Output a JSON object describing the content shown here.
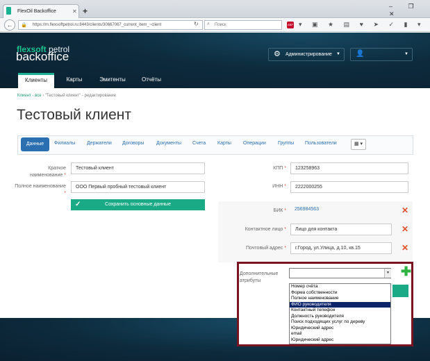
{
  "browser": {
    "tab_title": "FlexOil Backoffice",
    "new_tab": "+",
    "window_buttons": "– ❐ ✕",
    "url": "https://m.flexsoftpetrol.ru:8443/clients/30667067_current_item_~client",
    "search_placeholder": "Поиск",
    "abp": "ABP"
  },
  "brand": {
    "accent": "flexsoft",
    "rest": " petrol",
    "subtitle": "backoffice"
  },
  "header": {
    "admin_label": "Администрирование"
  },
  "nav": [
    "Клиенты",
    "Карты",
    "Эмитенты",
    "Отчёты"
  ],
  "breadcrumb": {
    "root": "Клиент - все",
    "separator": "›",
    "current": "\"Тестовый клиент\" - редактирование"
  },
  "page_title": "Тестовый клиент",
  "tabs": [
    "Данные",
    "Филиалы",
    "Держатели",
    "Договоры",
    "Документы",
    "Счета",
    "Карты",
    "Операции",
    "Группы",
    "Пользователи"
  ],
  "form_left": {
    "short_name_label": "Краткое наименование",
    "short_name_value": "Тестовый клиент",
    "full_name_label": "Полное наименование",
    "full_name_value": "ООО Первый пробный тестовый клиент",
    "save_label": "Сохранить основные данные"
  },
  "form_right": {
    "kpp_label": "КПП",
    "kpp_value": "123258963",
    "inn_label": "ИНН",
    "inn_value": "2222000255",
    "bik_label": "БИК",
    "bik_value": "256984563",
    "contact_label": "Контактное лицо",
    "contact_value": "Лицо для контакта",
    "address_label": "Почтовый адрес",
    "address_value": "г.Город, ул.Улица, д.10, кв.15"
  },
  "extra_attrs": {
    "label": "Дополнительные атрибуты",
    "options": [
      "Номер счёта",
      "Форма собственности",
      "Полное наименование",
      "ФИО руководителя",
      "Контактный телефон",
      "Должность руководителя",
      "Поиск подходящих услуг по дереву",
      "Юридический адрес",
      "email",
      "Юридический адрес"
    ],
    "selected_index": 3
  },
  "colors": {
    "accent_green": "#19b394",
    "link_blue": "#2a6fb0",
    "header_dark": "#0d2b3d",
    "delete_red": "#e2502c",
    "highlight_border": "#7a1420"
  }
}
